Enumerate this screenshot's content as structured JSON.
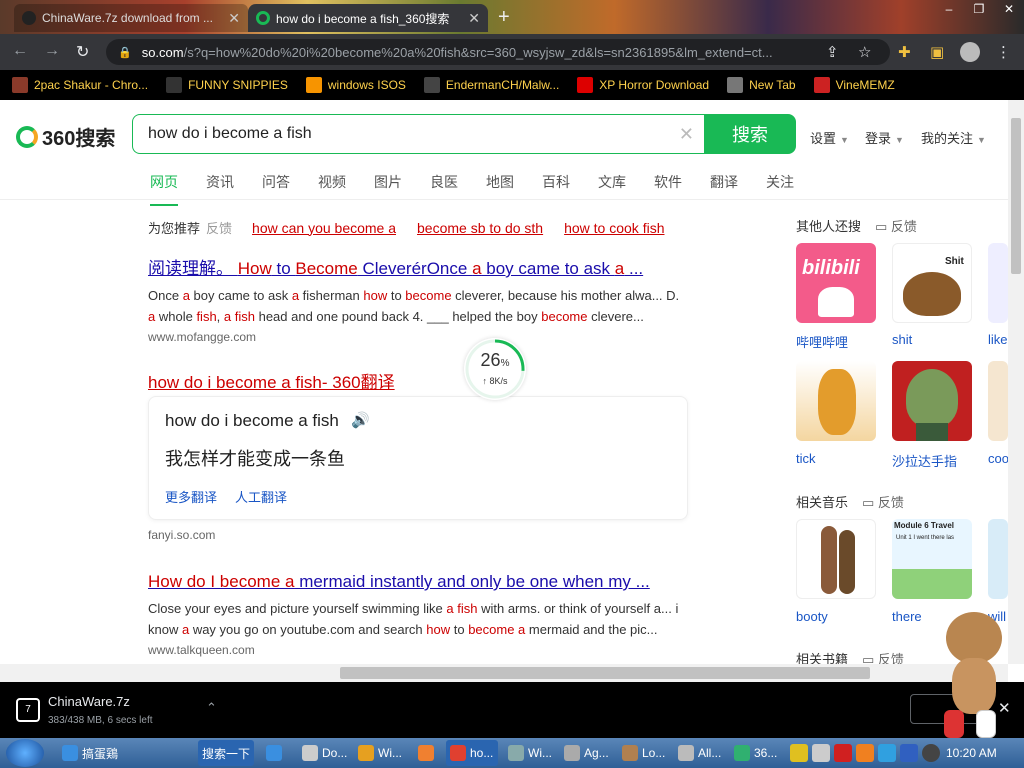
{
  "browser": {
    "tabs": [
      {
        "title": "ChinaWare.7z download from ...",
        "active": false
      },
      {
        "title": "how do i become a fish_360搜索",
        "active": true
      }
    ],
    "url_host": "so.com",
    "url_path": "/s?q=how%20do%20i%20become%20a%20fish&src=360_wsyjsw_zd&ls=sn2361895&lm_extend=ct...",
    "bookmarks": [
      {
        "label": "2pac Shakur - Chro...",
        "icon": "2pac-icon",
        "color": "#8a3a2a"
      },
      {
        "label": "FUNNY SNIPPIES",
        "icon": "h-icon",
        "color": "#333333"
      },
      {
        "label": "windows ISOS",
        "icon": "ph-icon",
        "color": "#f79400"
      },
      {
        "label": "EndermanCH/Malw...",
        "icon": "yp-icon",
        "color": "#444444"
      },
      {
        "label": "XP Horror Download",
        "icon": "x-icon",
        "color": "#dd0000"
      },
      {
        "label": "New Tab",
        "icon": "globe-icon",
        "color": "#777777"
      },
      {
        "label": "VineMEMZ",
        "icon": "r-icon",
        "color": "#cc2222"
      }
    ]
  },
  "search": {
    "logo": "360搜索",
    "query": "how do i become a fish",
    "button": "搜索",
    "settings": "设置",
    "login": "登录",
    "follow": "我的关注",
    "tabs": [
      "网页",
      "资讯",
      "问答",
      "视频",
      "图片",
      "良医",
      "地图",
      "百科",
      "文库",
      "软件",
      "翻译",
      "关注"
    ]
  },
  "suggest": {
    "label": "为您推荐",
    "feedback": "反馈",
    "links": [
      "how can you become a",
      "become sb to do sth",
      "how to cook fish"
    ]
  },
  "results": [
    {
      "title_a": "阅读理解。 ",
      "title_b": "How",
      "title_c": " to ",
      "title_d": "Become",
      "title_e": " CleverérOnce ",
      "title_f": "a",
      "title_g": " boy came to ask ",
      "title_h": "a",
      "title_i": " ...",
      "snip1_a": "Once ",
      "snip1_b": "a",
      "snip1_c": " boy came to ask ",
      "snip1_d": "a",
      "snip1_e": " fisherman ",
      "snip1_f": "how",
      "snip1_g": " to ",
      "snip1_h": "become",
      "snip1_i": " cleverer, because his mother alwa... D.",
      "snip2_a": "a",
      "snip2_b": " whole ",
      "snip2_c": "fish",
      "snip2_d": ", ",
      "snip2_e": "a fish",
      "snip2_f": " head and one pound back 4. ___ helped the boy ",
      "snip2_g": "become",
      "snip2_h": " clevere...",
      "site": "www.mofangge.com"
    },
    {
      "title": "how do i become a fish- 360翻译",
      "trans_src": "how do i become a fish",
      "trans_dst": "我怎样才能变成一条鱼",
      "more": "更多翻译",
      "human": "人工翻译",
      "site": "fanyi.so.com"
    },
    {
      "title_a": "How do I become a",
      "title_b": " mermaid instantly and only be one when my ...",
      "snip1_a": "Close your eyes and picture yourself swimming like ",
      "snip1_b": "a fish",
      "snip1_c": " with arms. or think of yourself a... i",
      "snip2_a": "know ",
      "snip2_b": "a",
      "snip2_c": " way you go on youtube.com and search ",
      "snip2_d": "how",
      "snip2_e": " to ",
      "snip2_f": "become a",
      "snip2_g": " mermaid and the pic...",
      "site": "www.talkqueen.com"
    }
  ],
  "progress": {
    "percent": 26,
    "pct_label": "26",
    "pct_sign": "%",
    "speed": "↑ 8K/s"
  },
  "sidebar": {
    "others": "其他人还搜",
    "feedback": "反馈",
    "items": [
      "哔哩哔哩",
      "shit",
      "like",
      "tick",
      "沙拉达手指",
      "coo"
    ],
    "music": "相关音乐",
    "music_items": [
      "booty",
      "there",
      "will"
    ],
    "books": "相关书籍",
    "thumb_text": {
      "bilibili": "bilibili",
      "shit": "Shit",
      "module_title": "Module 6 Travel",
      "module_sub": "Unit 1 I went there las"
    }
  },
  "download": {
    "name": "ChinaWare.7z",
    "meta": "383/438 MB, 6 secs left"
  },
  "taskbar": {
    "items": [
      "搞蛋鶏",
      "搜索一下",
      "Do...",
      "Wi...",
      "ho...",
      "Wi...",
      "Ag...",
      "Lo...",
      "All...",
      "36..."
    ],
    "clock": "10:20 AM"
  }
}
